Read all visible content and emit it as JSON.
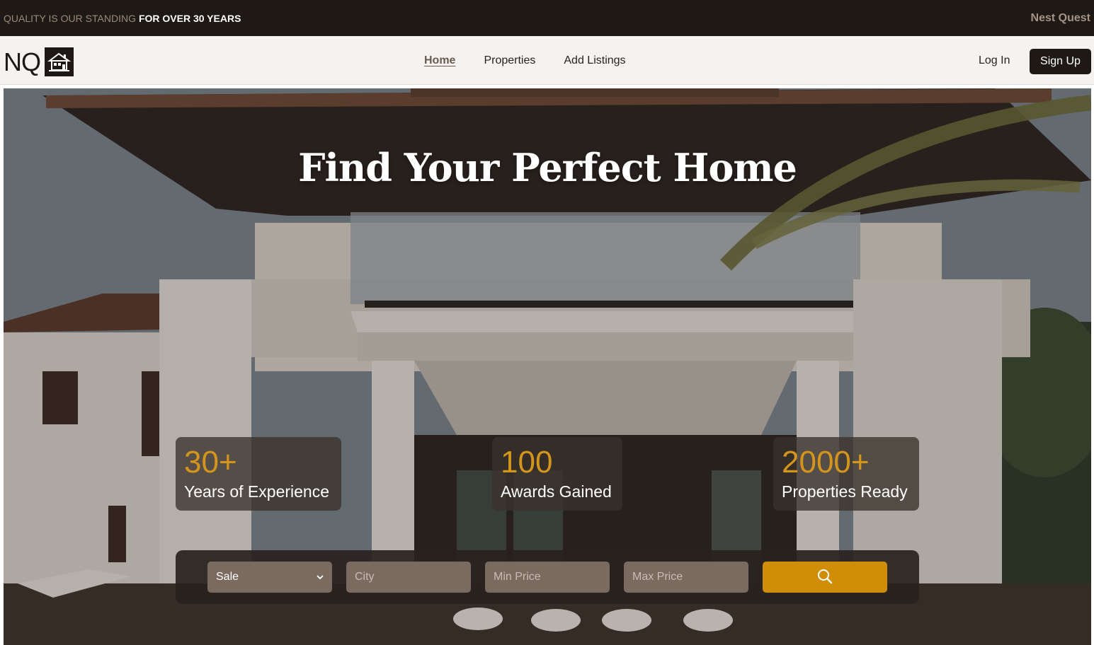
{
  "topbar": {
    "tagline_muted": "QUALITY IS OUR STANDING",
    "tagline_strong": "FOR OVER 30 YEARS",
    "brand": "Nest Quest"
  },
  "navbar": {
    "logo_text": "NQ",
    "logo_icon": "house-icon",
    "links": [
      "Home",
      "Properties",
      "Add Listings"
    ],
    "active_link": "Home",
    "login": "Log In",
    "signup": "Sign Up"
  },
  "hero": {
    "title": "Find Your Perfect Home",
    "stats": [
      {
        "value": "30+",
        "label": "Years of Experience"
      },
      {
        "value": "100",
        "label": "Awards Gained"
      },
      {
        "value": "2000+",
        "label": "Properties Ready"
      }
    ]
  },
  "search": {
    "type_selected": "Sale",
    "city_placeholder": "City",
    "min_price_placeholder": "Min Price",
    "max_price_placeholder": "Max Price",
    "search_icon": "search-icon"
  },
  "colors": {
    "dark": "#1e1915",
    "accent": "#d08d08",
    "stat_number": "#d4951c"
  }
}
